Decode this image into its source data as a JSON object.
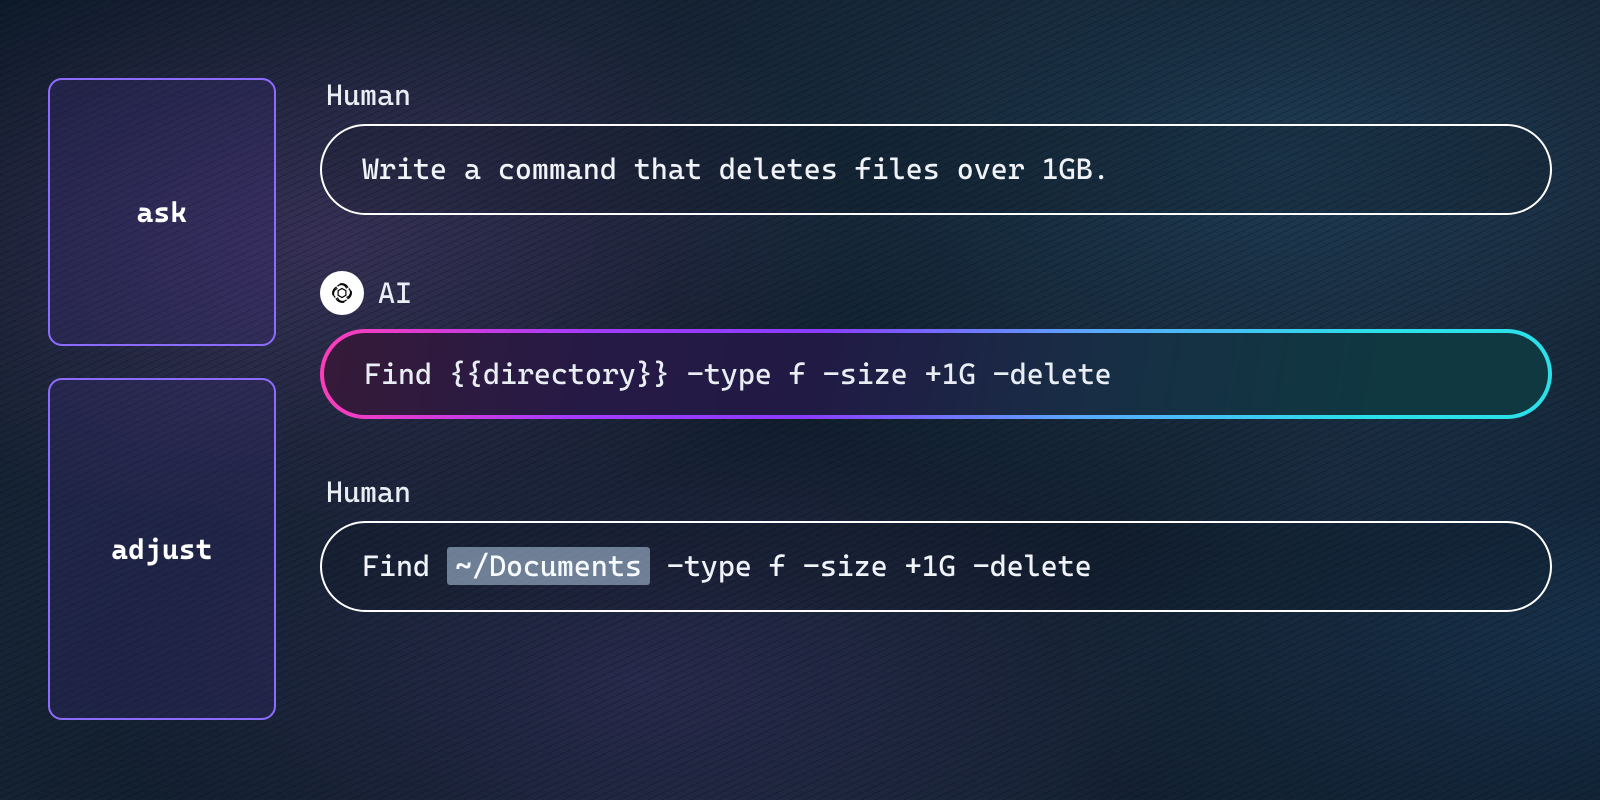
{
  "stages": {
    "ask": "ask",
    "adjust": "adjust"
  },
  "messages": {
    "human1": {
      "label": "Human",
      "body": "Write a command that deletes files over 1GB."
    },
    "ai1": {
      "label": "AI",
      "prefix": "Find ",
      "highlight": "{{directory}}",
      "suffix": " -type f -size +1G -delete"
    },
    "human2": {
      "label": "Human",
      "prefix": "Find ",
      "highlight": "~/Documents",
      "suffix": " -type f -size +1G -delete"
    }
  },
  "colors": {
    "stage_border": "#8c6cff",
    "bubble_border": "#ffffff",
    "highlight_bg": "rgba(180,205,230,0.55)",
    "ai_gradient": [
      "#ff3db8",
      "#a23cff",
      "#5aa8ff",
      "#2be0e8"
    ]
  }
}
